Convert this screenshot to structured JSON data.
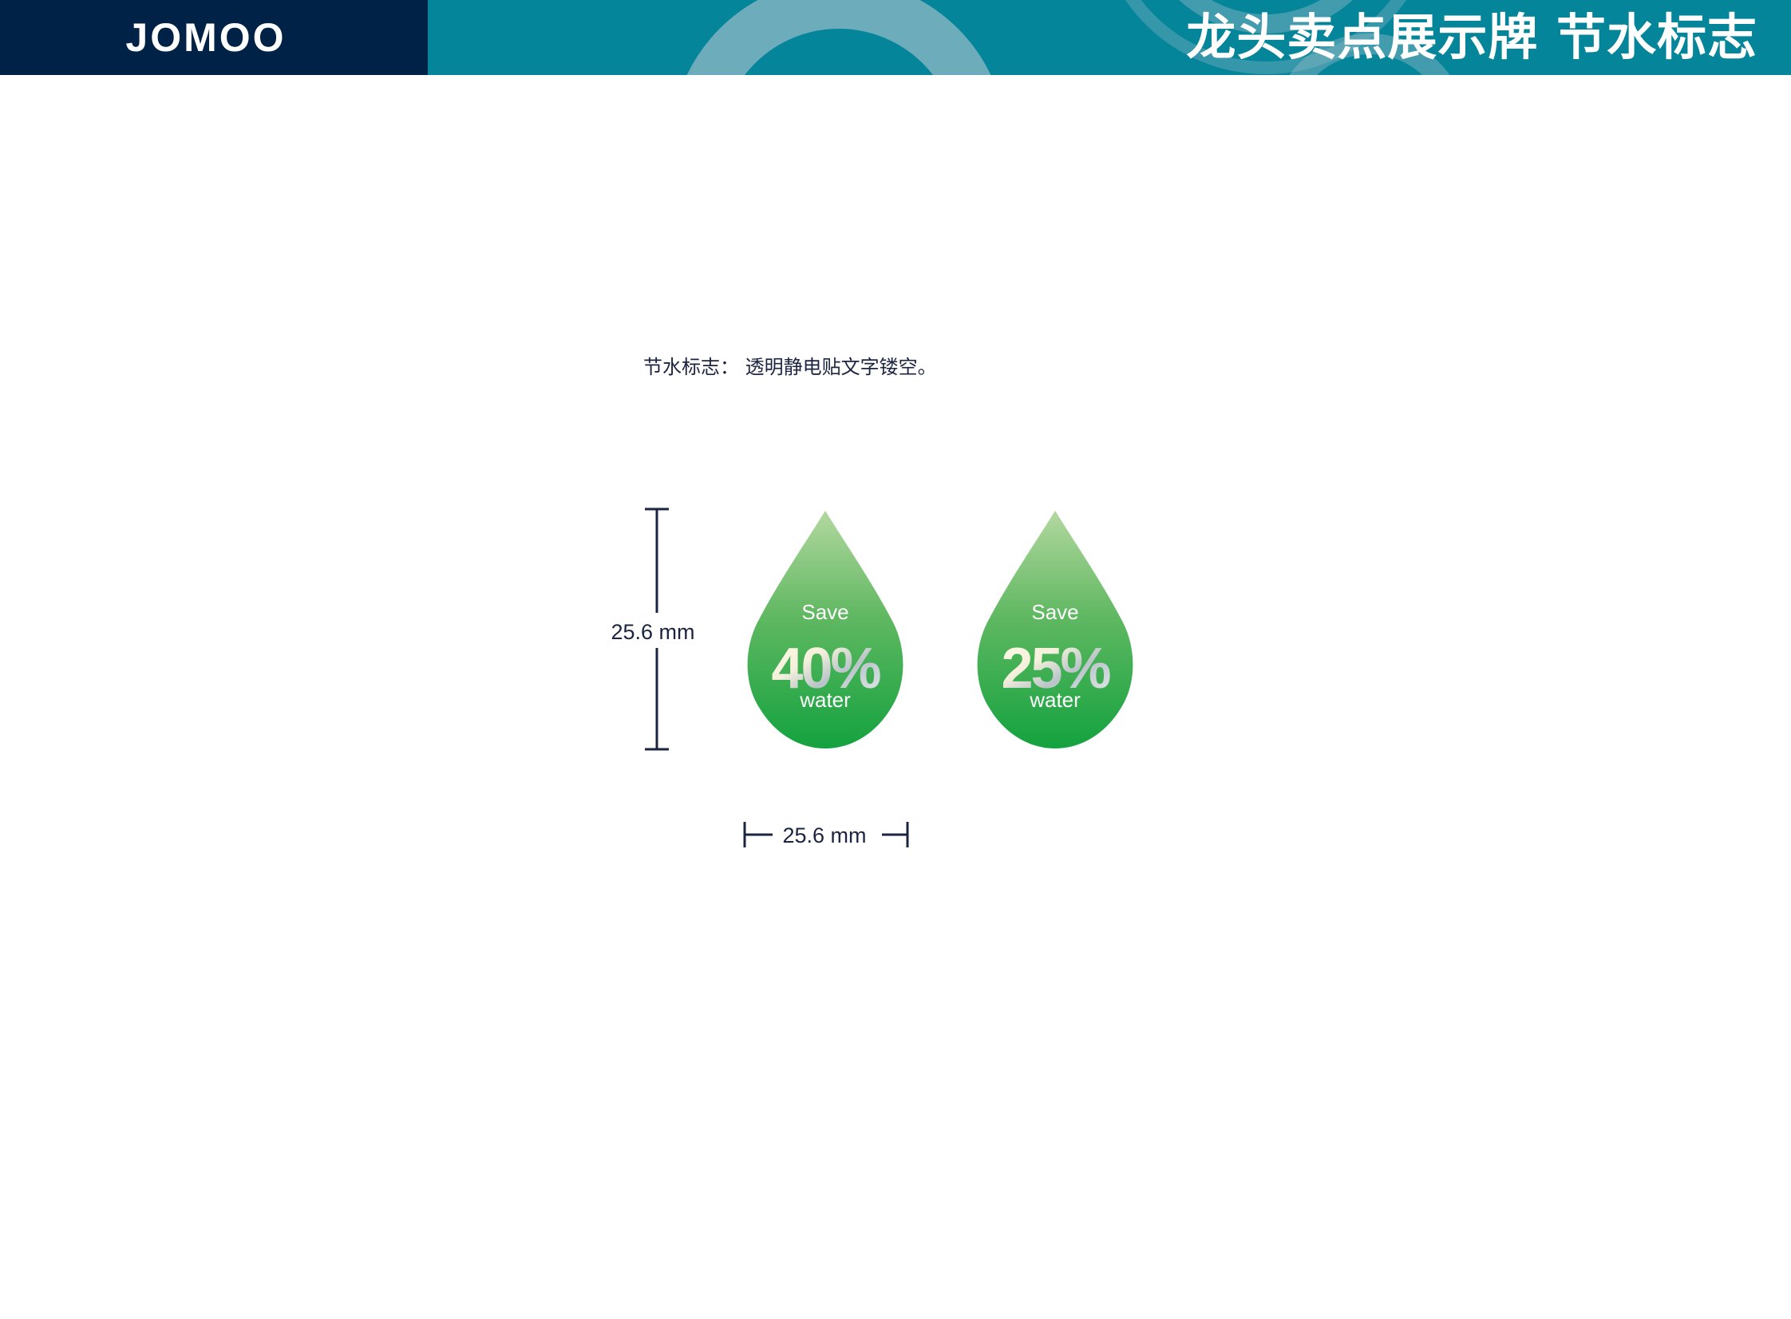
{
  "header": {
    "logo": "JOMOO",
    "title": "龙头卖点展示牌  节水标志",
    "colors": {
      "logo_bg": "#012247",
      "banner_bg": "#05859a"
    }
  },
  "caption": "节水标志： 透明静电贴文字镂空。",
  "dimensions": {
    "height_label": "25.6 mm",
    "width_label": "25.6 mm"
  },
  "badges": [
    {
      "save": "Save",
      "percent": "40%",
      "water": "water"
    },
    {
      "save": "Save",
      "percent": "25%",
      "water": "water"
    }
  ],
  "colors": {
    "drop_top": "#a6d290",
    "drop_bottom": "#14a23f",
    "dimension_line": "#1b2440"
  }
}
